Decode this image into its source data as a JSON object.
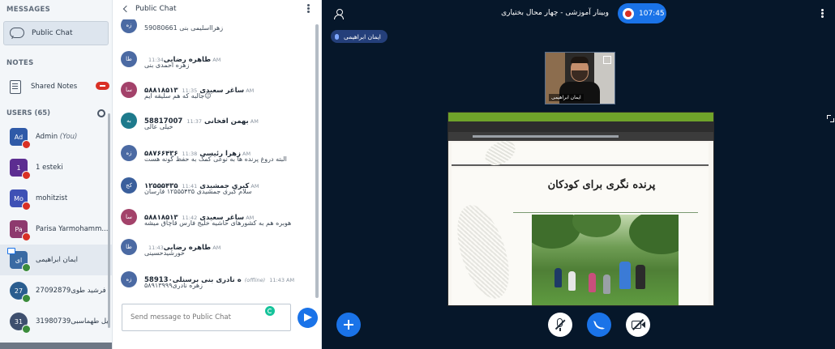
{
  "sidebar": {
    "messages_title": "MESSAGES",
    "public_chat_label": "Public Chat",
    "notes_title": "NOTES",
    "shared_notes_label": "Shared Notes",
    "users_title": "USERS (65)",
    "users": [
      {
        "initials": "Ad",
        "name": "Admin",
        "suffix": "(You)",
        "color": "#2f5aa8"
      },
      {
        "initials": "1",
        "name": "1 esteki",
        "suffix": "",
        "color": "#5c2d91"
      },
      {
        "initials": "Mo",
        "name": "mohitzist",
        "suffix": "",
        "color": "#3f51b5"
      },
      {
        "initials": "Pa",
        "name": "Parisa Yarmohamm...",
        "suffix": "",
        "color": "#8e3a6e"
      },
      {
        "initials": "ای",
        "name": "ایمان ابراهیمی",
        "suffix": "",
        "color": "#3a6aa3"
      },
      {
        "initials": "27",
        "name": "27092879فرشید طوی",
        "suffix": "",
        "color": "#2a5d8f"
      },
      {
        "initials": "31",
        "name": "31980739یل طهماسبی",
        "suffix": "",
        "color": "#3e4f6e"
      }
    ]
  },
  "chat": {
    "title": "Public Chat",
    "input_placeholder": "Send message to Public Chat",
    "messages": [
      {
        "initials": "زه",
        "name": "",
        "time": "",
        "offline": "",
        "text": "زهرااسلیمی بنی 59080661",
        "color": "#4b6aa3"
      },
      {
        "initials": "طا",
        "name": "طاهره رضایی",
        "time": "11:34 AM",
        "offline": "",
        "text": "زهره احمدی بنی",
        "color": "#4b6aa3"
      },
      {
        "initials": "سا",
        "name": "ساغر سعیدی ۵۸۸۱۸۵۱۳",
        "time": "11:35 AM",
        "offline": "",
        "text": "☺جالبه که هم سلیقه ایم",
        "color": "#a3426a"
      },
      {
        "initials": "به",
        "name": "بهمن افخانی 58817007",
        "time": "11:37 AM",
        "offline": "",
        "text": "خیلی عالی",
        "color": "#1e7a8c"
      },
      {
        "initials": "زه",
        "name": "زهرا رئیسی ۵۸۷۶۶۴۳۶",
        "time": "11:38 AM",
        "offline": "",
        "text": "البته دروغ پرنده ها به نوعی کمک به حفظ گونه هست",
        "color": "#4b6aa3"
      },
      {
        "initials": "کج",
        "name": "کبری جمشیدی ۱۲۵۵۵۴۳۵",
        "time": "11:41 AM",
        "offline": "",
        "text": "سلام کبری جمشیدی ۱۲۵۵۵۴۳۵ فارسان",
        "color": "#3a5f9c"
      },
      {
        "initials": "سا",
        "name": "ساغر سعیدی ۵۸۸۱۸۵۱۳",
        "time": "11:42 AM",
        "offline": "",
        "text": "هوبره هم به کشورهای حاشیه خلیج فارس قاچاق میشه",
        "color": "#a3426a"
      },
      {
        "initials": "طا",
        "name": "طاهره رضایی",
        "time": "11:43 AM",
        "offline": "",
        "text": "خورشیدحسینی",
        "color": "#4b6aa3"
      },
      {
        "initials": "زه",
        "name": "58913۰ه نادری بنی برسنلی",
        "time": "11:43 AM",
        "offline": "(offline)",
        "text": "زهره نادری۵۸۹۱۳۹۹۹",
        "color": "#4b6aa3"
      }
    ]
  },
  "stage": {
    "meeting_title": "وبینار آموزشی - چهار محال بختیاری",
    "record_time": "107:45",
    "talker_name": "ایمان ابراهیمی",
    "webcam_name": "ایمان ابراهیمی",
    "slide_title": "پرنده نگری برای کودکان"
  },
  "colors": {
    "accent": "#1a73e8",
    "stage_bg": "#06172a",
    "recording": "#d93025"
  },
  "icons": {
    "plus": "plus-icon",
    "mute": "mic-off-icon",
    "phone": "phone-icon",
    "camera": "camera-off-icon",
    "send": "send-icon"
  }
}
